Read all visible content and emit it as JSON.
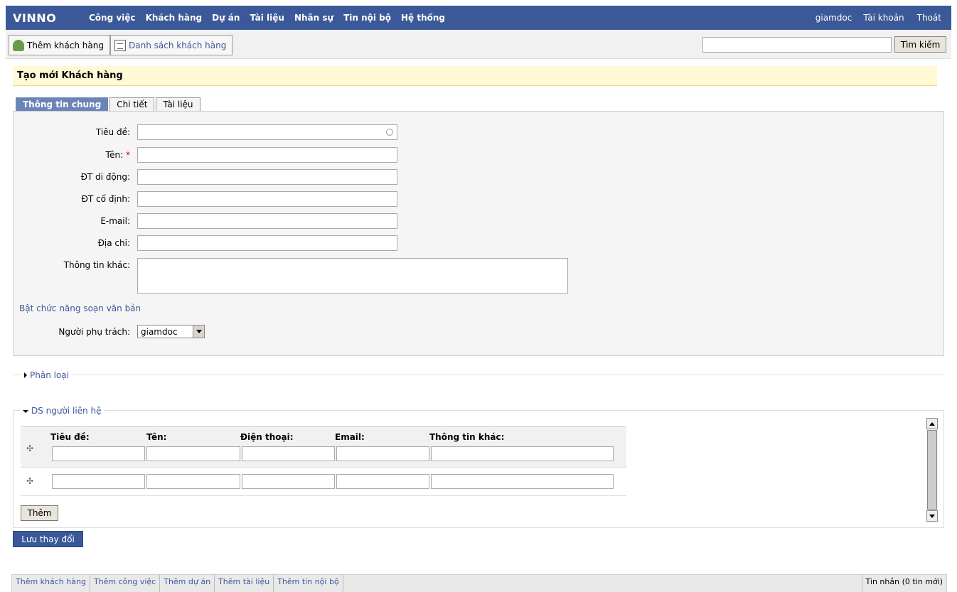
{
  "nav": {
    "brand": "VINNO",
    "menu": [
      "Công việc",
      "Khách hàng",
      "Dự án",
      "Tài liệu",
      "Nhân sự",
      "Tin nội bộ",
      "Hệ thống"
    ],
    "user": "giamdoc",
    "account": "Tài khoản",
    "logout": "Thoát"
  },
  "toolbar": {
    "add_customer": "Thêm khách hàng",
    "customer_list": "Danh sách khách hàng",
    "search_value": "",
    "search_button": "Tìm kiếm"
  },
  "page_title": "Tạo mới Khách hàng",
  "tabs": [
    "Thông tin chung",
    "Chi tiết",
    "Tài liệu"
  ],
  "form": {
    "title_label": "Tiêu đề:",
    "name_label": "Tên:",
    "required_mark": "*",
    "mobile_label": "ĐT di động:",
    "phone_label": "ĐT cố định:",
    "email_label": "E-mail:",
    "address_label": "Địa chỉ:",
    "other_label": "Thông tin khác:",
    "editor_link": "Bật chức năng soạn văn bản",
    "owner_label": "Người phụ trách:",
    "owner_value": "giamdoc"
  },
  "sections": {
    "classification": "Phân loại",
    "contacts": "DS người liên hệ"
  },
  "contacts": {
    "headers": [
      "Tiêu đề:",
      "Tên:",
      "Điện thoại:",
      "Email:",
      "Thông tin khác:"
    ],
    "add_button": "Thêm"
  },
  "save_button": "Lưu thay đổi",
  "footer": {
    "links": [
      "Thêm khách hàng",
      "Thêm công việc",
      "Thêm dự án",
      "Thêm tài liệu",
      "Thêm tin nội bộ"
    ],
    "messages": "Tin nhắn (0 tin mới)"
  },
  "colors": {
    "nav": "#3b5998",
    "title_bg": "#fff9d6",
    "active_tab": "#6b84b8"
  }
}
